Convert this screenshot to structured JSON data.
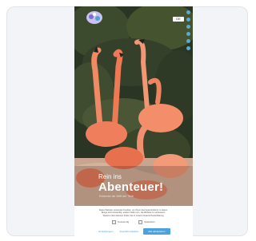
{
  "hero": {
    "line1": "Rein ins",
    "line2": "Abenteuer!",
    "subline": "Entdecke die Welt der Tiere"
  },
  "header": {
    "language": "DE"
  },
  "consent": {
    "text_lines": [
      "Diese Website verwendet Cookies, um Ihnen das beste Erlebnis zu bieten.",
      "Einige sind notwendig, andere helfen uns, die Website zu verbessern.",
      "Weitere Informationen finden Sie in unserer Datenschutzerklärung."
    ],
    "options": [
      "Notwendig",
      "Statistiken"
    ],
    "buttons": {
      "settings": "Einstellungen",
      "select": "Auswahl erlauben",
      "accept_all": "Alle akzeptieren"
    }
  },
  "colors": {
    "accent": "#4aa3dc",
    "flamingo": "#ef7f5c",
    "foliage": "#2b3524"
  }
}
